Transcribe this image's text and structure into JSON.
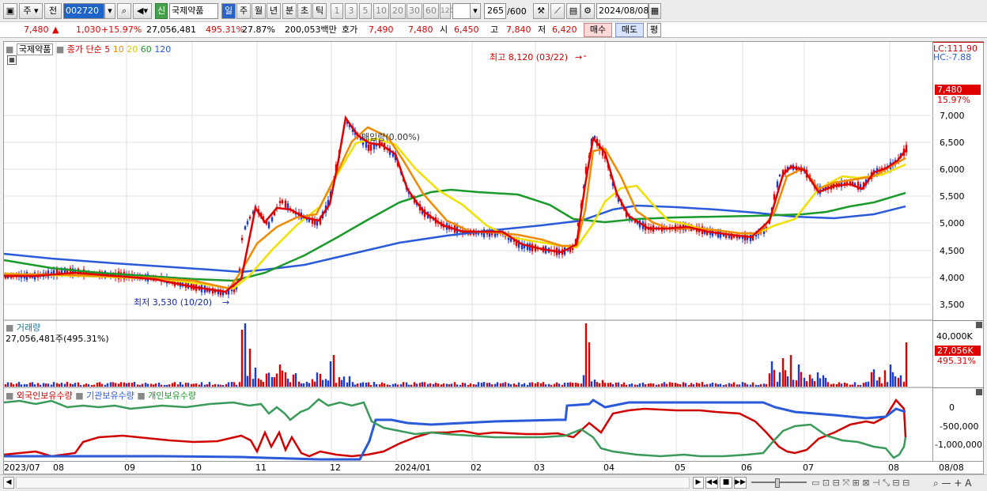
{
  "toolbar": {
    "period_jun": "주",
    "prev_label": "전",
    "code": "002720",
    "new_badge": "신",
    "stock_name": "국제약품",
    "periods": [
      "일",
      "주",
      "월",
      "년",
      "분",
      "초",
      "틱"
    ],
    "active_period": "일",
    "intervals": [
      "1",
      "3",
      "5",
      "10",
      "20",
      "30",
      "60",
      "120"
    ],
    "count": "265",
    "count_total": "/600",
    "date": "2024/08/08"
  },
  "info": {
    "price": "7,480",
    "arrow": "▲",
    "change": "1,030",
    "change_pct": "+15.97%",
    "volume": "27,056,481",
    "volume_pct": "495.31%",
    "turnover": "27.87%",
    "amount": "200,053백만",
    "quote_label": "호가",
    "ask": "7,490",
    "bid": "7,480",
    "open_label": "시",
    "open": "6,450",
    "high_label": "고",
    "high": "7,840",
    "low_label": "저",
    "low": "6,420",
    "buy": "매수",
    "sell": "매도",
    "eval": "평"
  },
  "price_panel": {
    "title": "국제약품",
    "legend_main": "종가 단순",
    "ma": [
      {
        "label": "5",
        "color": "#e00000"
      },
      {
        "label": "10",
        "color": "#f08a00"
      },
      {
        "label": "20",
        "color": "#f0e000"
      },
      {
        "label": "60",
        "color": "#1a9a2a"
      },
      {
        "label": "120",
        "color": "#2a5ad8"
      }
    ],
    "high_note": "최고 8,120 (03/22)",
    "low_note": "최저 3,530 (10/20)",
    "lock_note": "매입량(0.00%)",
    "lc_label": "LC:111.90",
    "hc_label": "HC:-7.88",
    "cur_price": "7,480",
    "cur_pct": "15.97%",
    "yticks": [
      "7,000",
      "6,500",
      "6,000",
      "5,500",
      "5,000",
      "4,500",
      "4,000",
      "3,500"
    ]
  },
  "volume_panel": {
    "title": "거래량",
    "value": "27,056,481주(495.31%)",
    "ytick": "40,000K",
    "cur_vol": "27,056K",
    "cur_pct": "495.31%"
  },
  "holding_panel": {
    "legend": [
      "외국인보유수량",
      "기관보유수량",
      "개인보유수량"
    ],
    "colors": [
      "#d00000",
      "#2a5ad8",
      "#1a9a2a"
    ],
    "yticks": [
      "0",
      "-500,000",
      "-1,000,000"
    ]
  },
  "xaxis": [
    "2023/07",
    "08",
    "09",
    "10",
    "11",
    "12",
    "2024/01",
    "02",
    "03",
    "04",
    "05",
    "06",
    "07",
    "08",
    "08/08"
  ]
}
